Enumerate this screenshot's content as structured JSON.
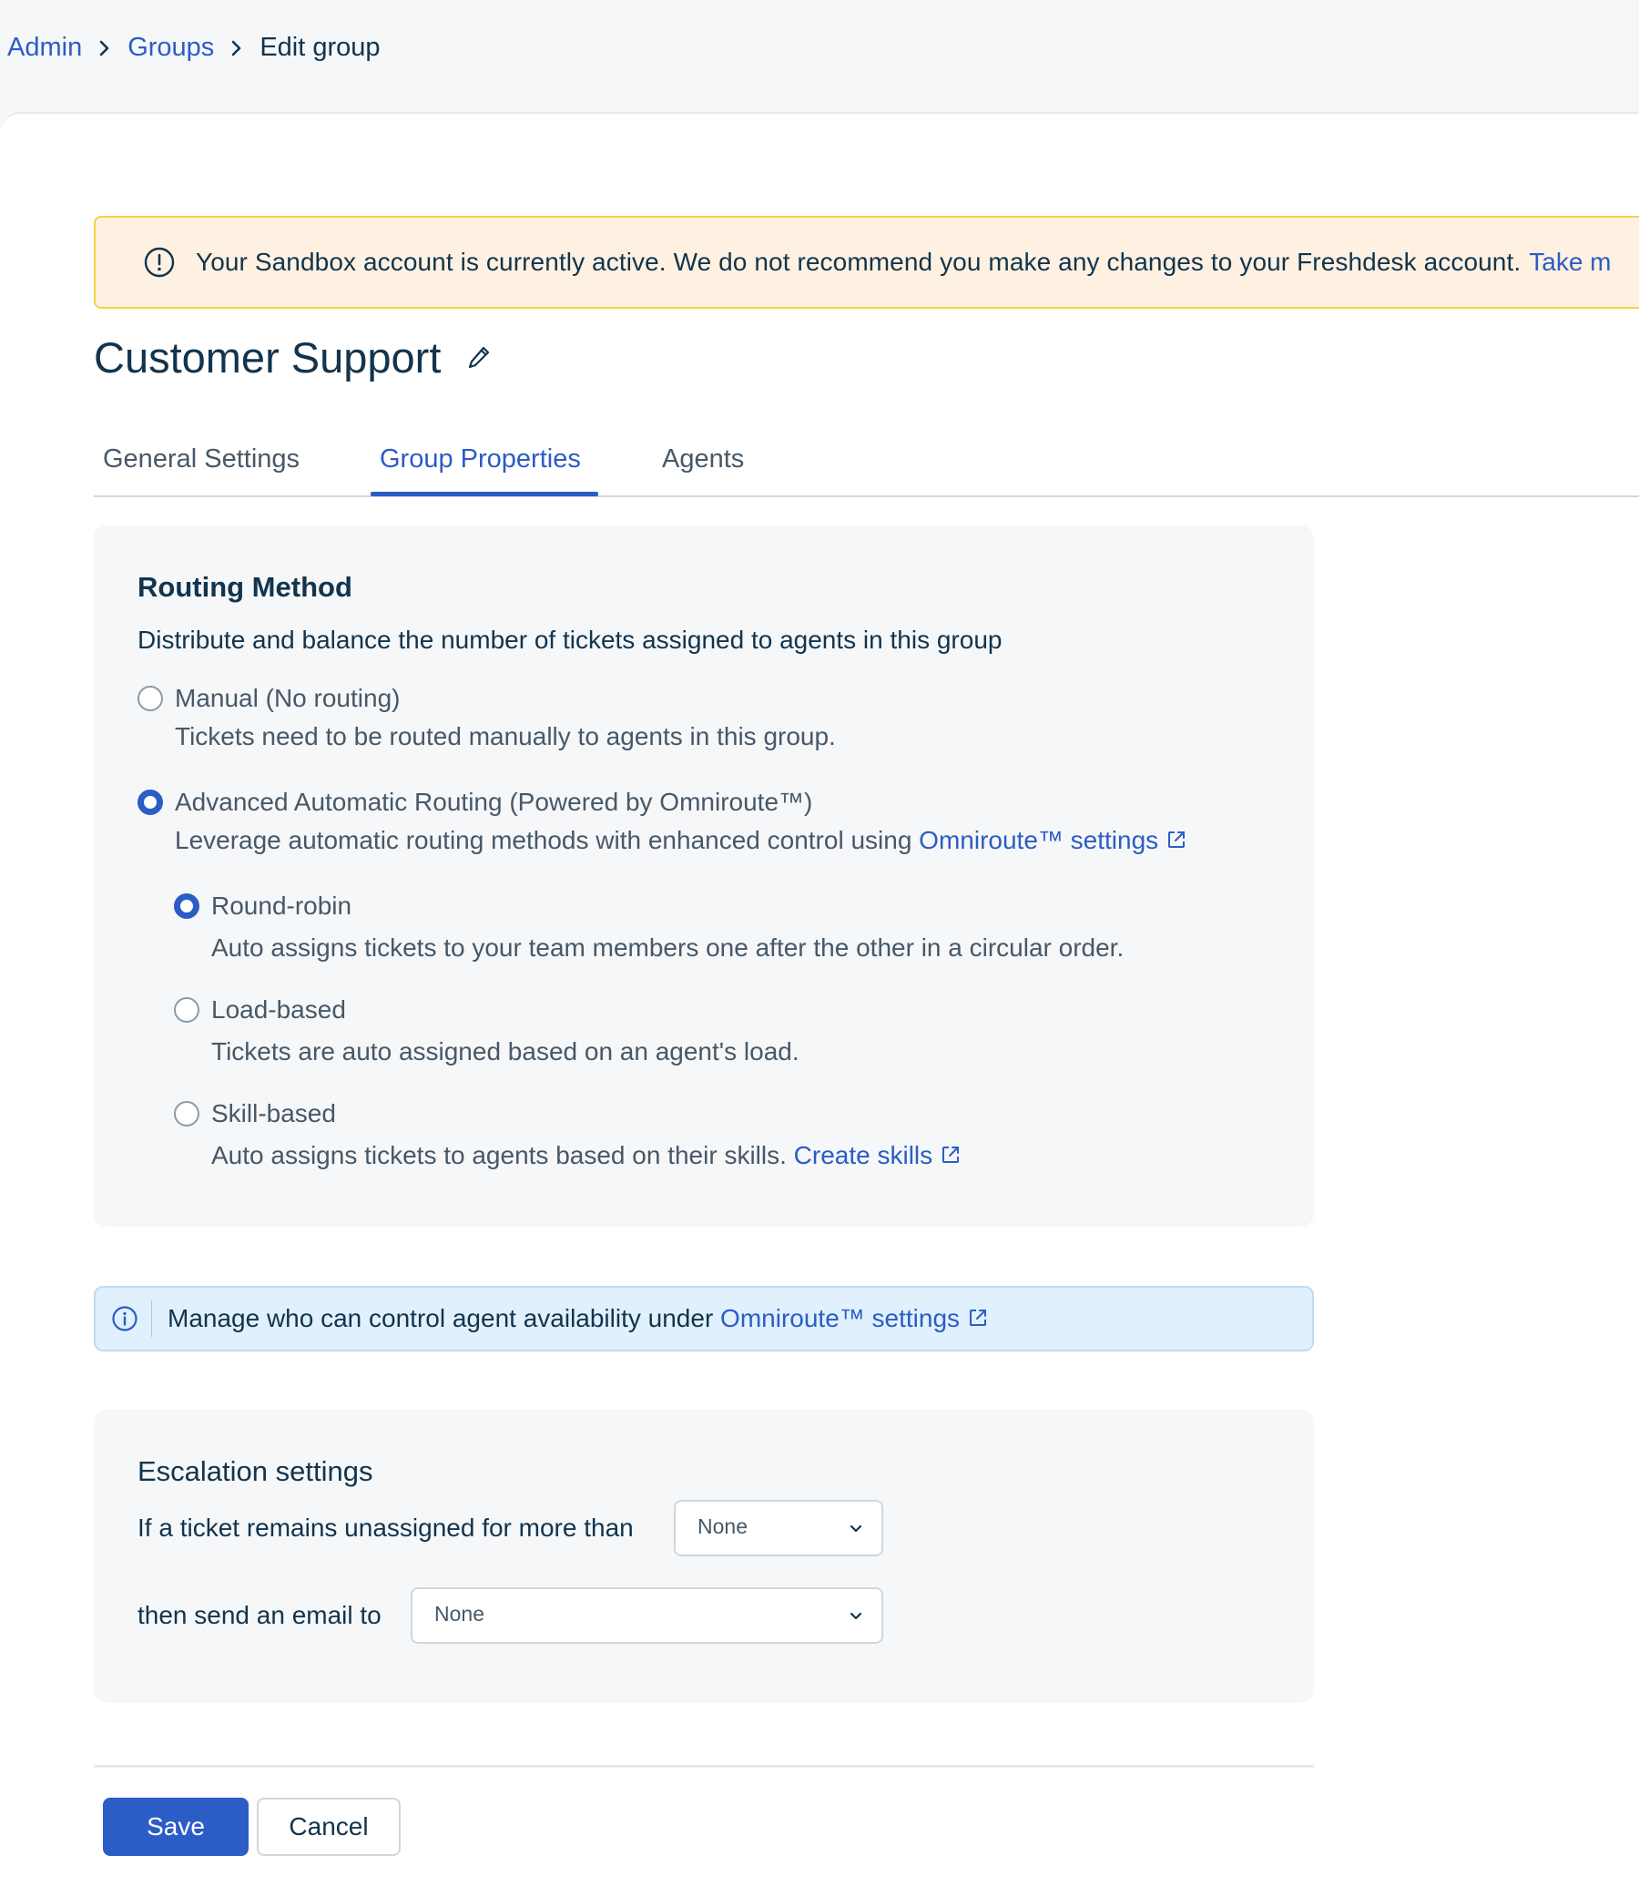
{
  "breadcrumb": {
    "items": [
      {
        "label": "Admin"
      },
      {
        "label": "Groups"
      },
      {
        "label": "Edit group"
      }
    ]
  },
  "sandbox_banner": {
    "message": "Your Sandbox account is currently active. We do not recommend you make any changes to your Freshdesk account.",
    "link_label": "Take m"
  },
  "page": {
    "title": "Customer Support"
  },
  "tabs": [
    {
      "label": "General Settings",
      "active": false
    },
    {
      "label": "Group Properties",
      "active": true
    },
    {
      "label": "Agents",
      "active": false
    }
  ],
  "routing": {
    "title": "Routing Method",
    "description": "Distribute and balance the number of tickets assigned to agents in this group",
    "options": [
      {
        "label": "Manual",
        "suffix": "(No routing)",
        "help": "Tickets need to be routed manually to agents in this group.",
        "selected": false
      },
      {
        "label": "Advanced Automatic Routing",
        "suffix": "(Powered by Omniroute™)",
        "help": "Leverage automatic routing methods with enhanced control using",
        "link": "Omniroute™ settings",
        "selected": true
      }
    ],
    "sub_options": [
      {
        "label": "Round-robin",
        "help": "Auto assigns tickets to your team members one after the other in a circular order.",
        "selected": true
      },
      {
        "label": "Load-based",
        "help": "Tickets are auto assigned based on an agent's load.",
        "selected": false
      },
      {
        "label": "Skill-based",
        "help": "Auto assigns tickets to agents based on their skills.",
        "link": "Create skills",
        "selected": false
      }
    ]
  },
  "info_banner": {
    "text": "Manage who can control agent availability under",
    "link": "Omniroute™ settings"
  },
  "escalation": {
    "title": "Escalation settings",
    "unassigned_label": "If a ticket remains unassigned for more than",
    "unassigned_value": "None",
    "email_label": "then send an email to",
    "email_value": "None"
  },
  "footer": {
    "save_label": "Save",
    "cancel_label": "Cancel"
  },
  "colors": {
    "accent": "#2c5cc5",
    "text": "#12344d",
    "banner_warning_bg": "#fef1e1",
    "banner_warning_border": "#f1d245",
    "banner_info_bg": "#e0f0fd"
  }
}
